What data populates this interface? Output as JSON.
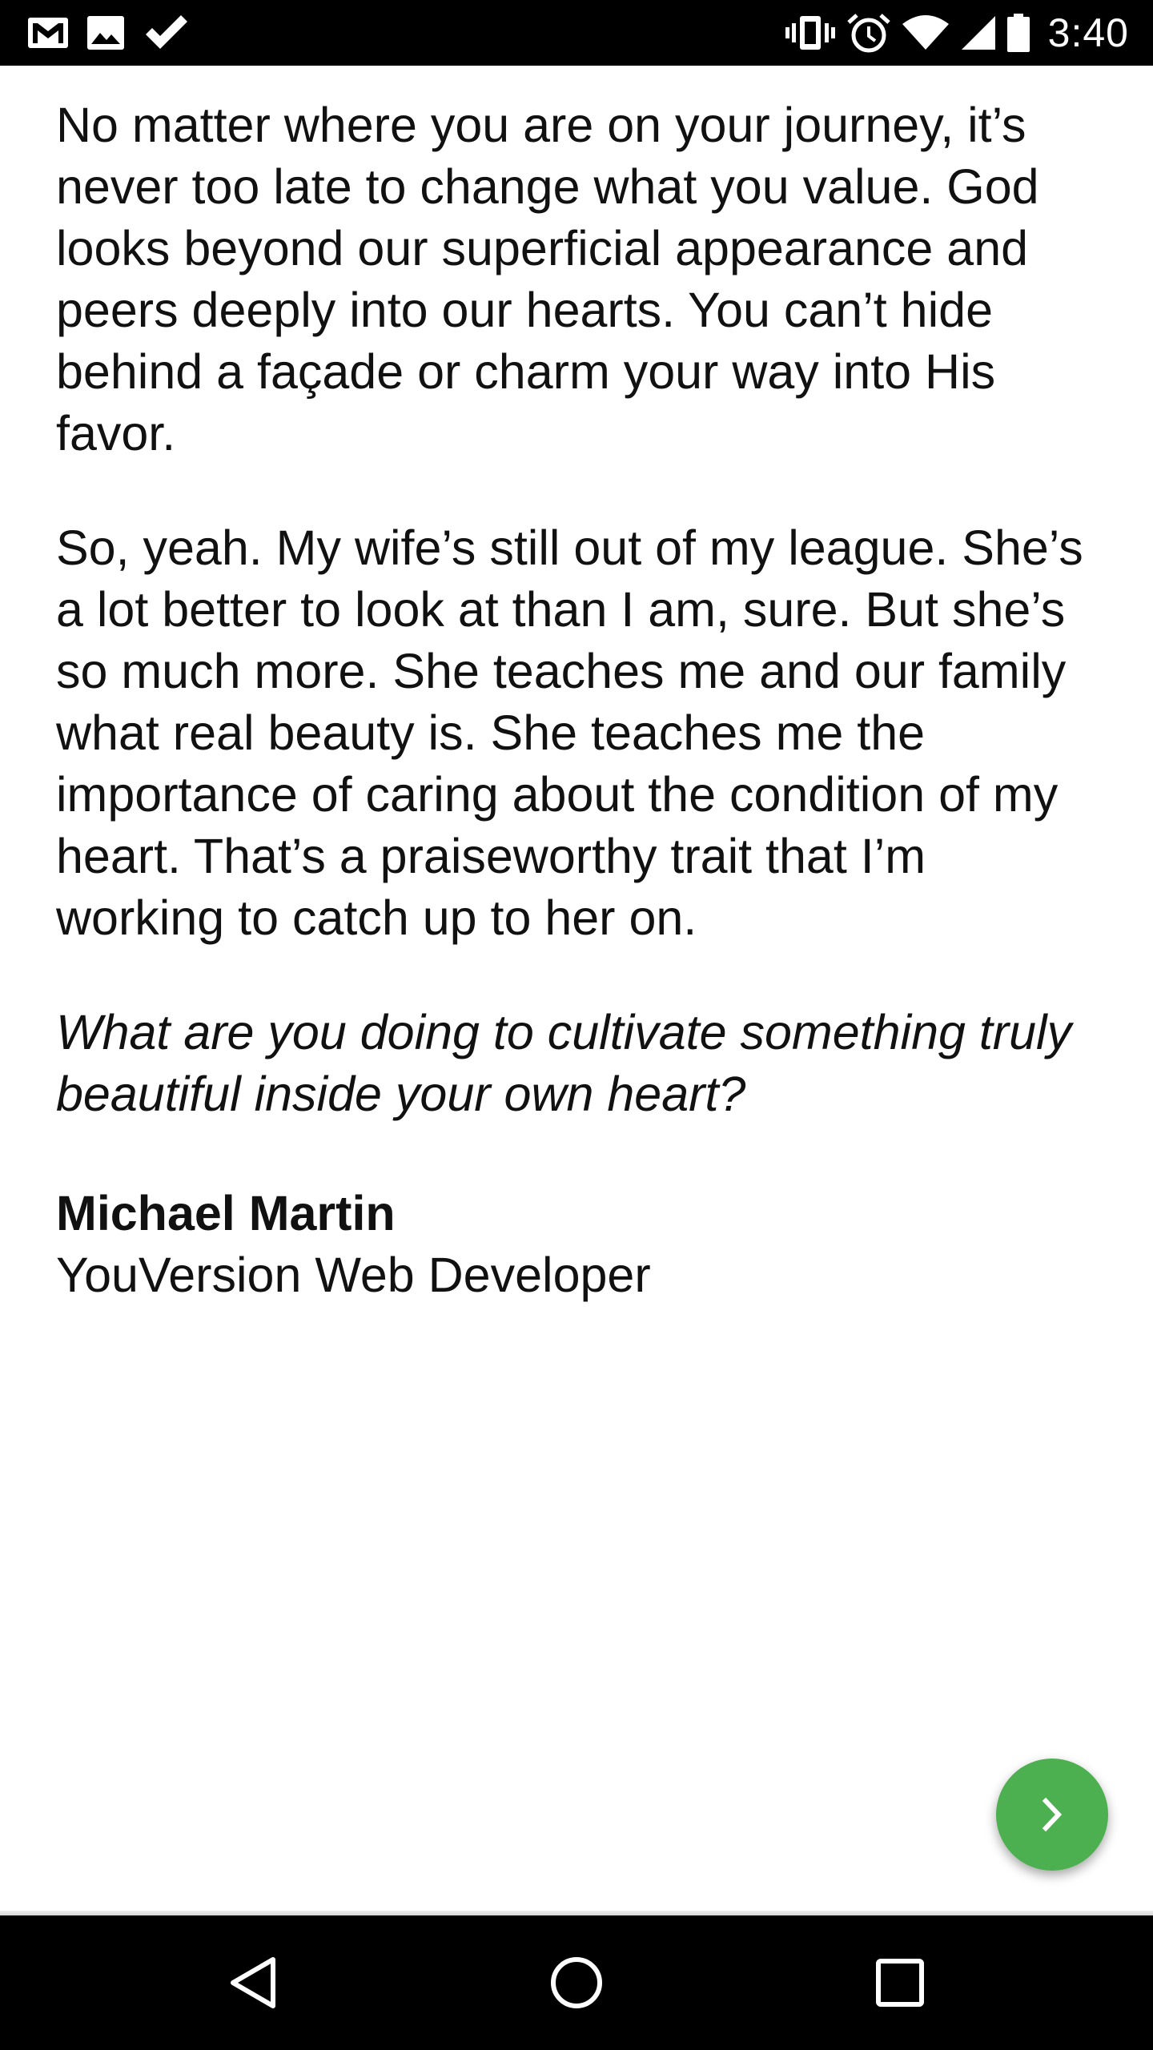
{
  "status_bar": {
    "time": "3:40",
    "left_icons": [
      "gmail-icon",
      "image-icon",
      "check-icon"
    ],
    "right_icons": [
      "vibrate-icon",
      "alarm-icon",
      "wifi-icon",
      "signal-icon",
      "battery-icon"
    ]
  },
  "article": {
    "paragraph_1": "No matter where you are on your journey, it’s never too late to change what you value. God looks beyond our superficial appearance and peers deeply into our hearts. You can’t hide behind a façade or charm your way into His favor.",
    "paragraph_2": "So, yeah. My wife’s still out of my league. She’s a lot better to look at than I am, sure. But she’s so much more. She teaches me and our family what real beauty is. She teaches me the importance of caring about the condition of my heart. That’s a praiseworthy trait that I’m working to catch up to her on.",
    "question": "What are you doing to cultivate something truly beautiful inside your own heart?",
    "author_name": "Michael Martin",
    "author_role": "YouVersion Web Developer"
  },
  "fab": {
    "icon": "chevron-right-icon",
    "color": "#4caf50"
  },
  "nav_bar": {
    "icons": [
      "back-icon",
      "home-icon",
      "recents-icon"
    ]
  }
}
